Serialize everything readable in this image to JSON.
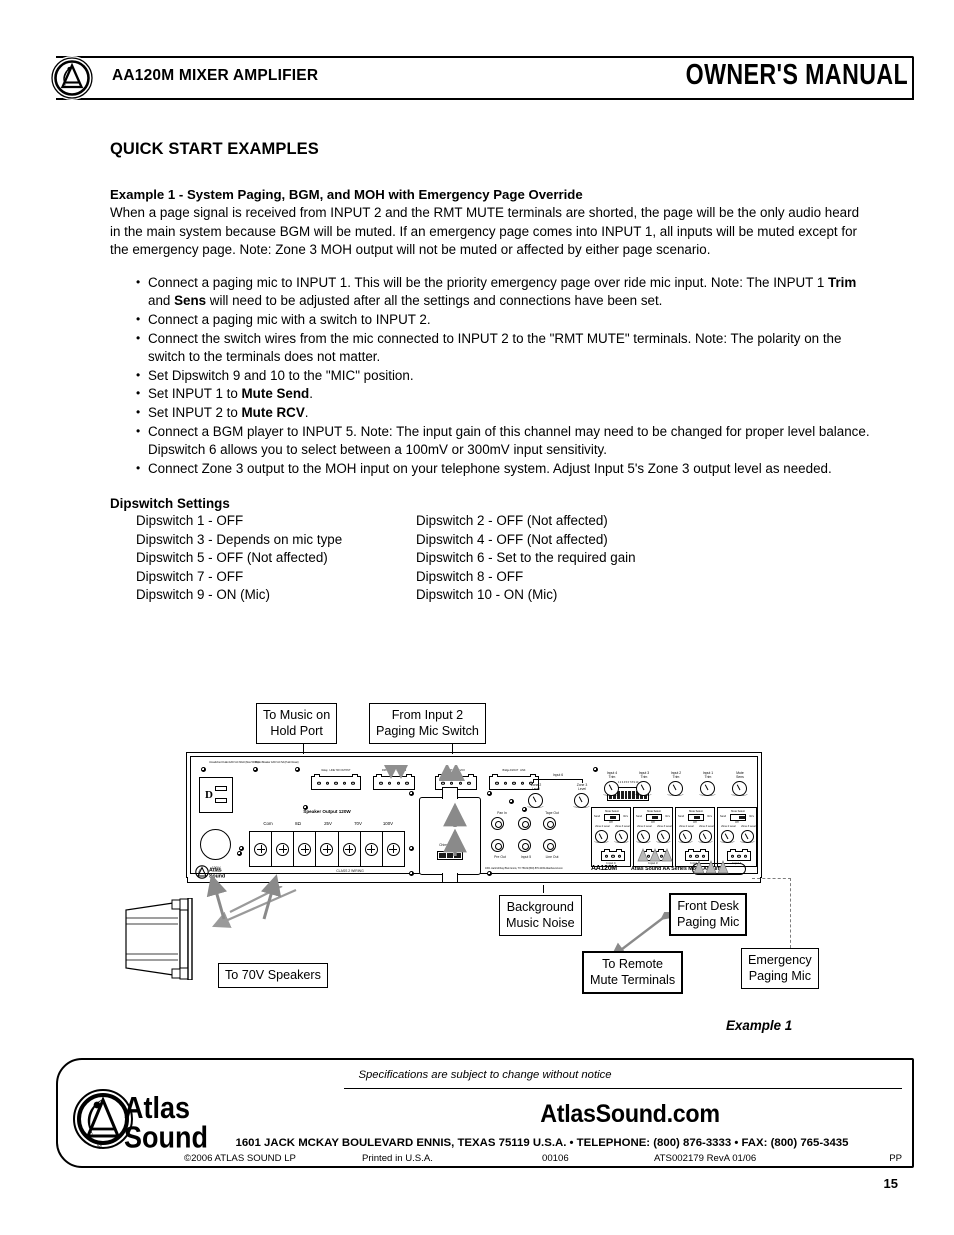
{
  "header": {
    "product_title": "AA120M MIXER AMPLIFIER",
    "manual_label": "OWNER'S MANUAL",
    "logo_name": "atlas-sound-logo"
  },
  "section": {
    "title": "QUICK START EXAMPLES",
    "example_title": "Example 1 - System Paging, BGM, and MOH with Emergency Page Override",
    "intro": "When a page signal is received from INPUT 2 and the RMT MUTE terminals are shorted, the page will be the only audio heard in the main system because BGM will be muted. If an emergency page comes into INPUT 1, all inputs will be muted except for the emergency page. Note: Zone 3 MOH output will not be muted or affected by either page scenario."
  },
  "steps": [
    {
      "parts": [
        {
          "t": "Connect a paging mic to INPUT 1. This will be the priority emergency page over ride mic input. Note: The INPUT 1 ",
          "b": false
        },
        {
          "t": "Trim",
          "b": true
        },
        {
          "t": " and ",
          "b": false
        },
        {
          "t": "Sens",
          "b": true
        },
        {
          "t": " will need to be adjusted after all the settings and connections have been set.",
          "b": false
        }
      ]
    },
    {
      "parts": [
        {
          "t": "Connect a paging mic with a switch to INPUT 2.",
          "b": false
        }
      ]
    },
    {
      "parts": [
        {
          "t": "Connect the switch wires from the mic connected to INPUT 2 to the \"RMT MUTE\" terminals. Note: The polarity on the switch to the terminals does not matter.",
          "b": false
        }
      ]
    },
    {
      "parts": [
        {
          "t": "Set Dipswitch 9 and 10 to the \"MIC\" position.",
          "b": false
        }
      ]
    },
    {
      "parts": [
        {
          "t": "Set INPUT 1 to ",
          "b": false
        },
        {
          "t": "Mute Send",
          "b": true
        },
        {
          "t": ".",
          "b": false
        }
      ]
    },
    {
      "parts": [
        {
          "t": "Set INPUT 2 to ",
          "b": false
        },
        {
          "t": "Mute RCV",
          "b": true
        },
        {
          "t": ".",
          "b": false
        }
      ]
    },
    {
      "parts": [
        {
          "t": "Connect a BGM player to INPUT 5. Note: The input gain of this channel may need to be changed for proper level balance. Dipswitch 6 allows you to select between a 100mV or 300mV input sensitivity.",
          "b": false
        }
      ]
    },
    {
      "parts": [
        {
          "t": "Connect Zone 3 output to the MOH input on your telephone system. Adjust Input 5's Zone 3 output level as needed.",
          "b": false
        }
      ]
    }
  ],
  "dipswitch": {
    "heading": "Dipswitch Settings",
    "rows": [
      {
        "left": "Dipswitch 1 - OFF",
        "right": "Dipswitch 2 - OFF (Not affected)"
      },
      {
        "left": "Dipswitch 3 - Depends on mic type",
        "right": "Dipswitch 4 - OFF (Not affected)"
      },
      {
        "left": "Dipswitch 5 - OFF (Not affected)",
        "right": "Dipswitch 6 - Set to the required gain"
      },
      {
        "left": "Dipswitch 7 - OFF",
        "right": "Dipswitch 8 - OFF"
      },
      {
        "left": "Dipswitch 9 - ON (Mic)",
        "right": "Dipswitch 10 - ON (Mic)"
      }
    ]
  },
  "diagram": {
    "caption": "Example 1",
    "callouts": {
      "music_on_hold": "To Music on\nHold Port",
      "from_input2": "From Input 2\nPaging Mic Switch",
      "background_music": "Background\nMusic Noise",
      "front_desk": "Front Desk\nPaging Mic",
      "remote_mute": "To Remote\nMute Terminals",
      "emergency_mic": "Emergency\nPaging Mic",
      "speakers_70v": "To 70V Speakers"
    },
    "panel": {
      "model": "AA120M",
      "model_sub": "Atlas Sound AA Series Mixer Amplifier",
      "unswitched_outlet": "Unswitched Outlet\n120V AC 60Hz\n(Max 500W)",
      "outlet_breaker": "Outlet Breaker\n120V AC 5A\n(Push Reset)",
      "speaker_output": "Speaker Output 120W",
      "speaker_taps": [
        "Com",
        "8Ω",
        "25V",
        "70V",
        "100V"
      ],
      "class2": "CLASS 2 WIRING",
      "wattage": "120W",
      "chime_module": "Chime Module",
      "jacks": [
        "Pan In",
        "Tape Out",
        "Pre Out",
        "Line Out"
      ],
      "input5_label": "Input 5",
      "input6_label": "Input 6",
      "zone_labels": [
        "Zone 2\nLevel",
        "Zone 3\nLevel"
      ],
      "dip_numbers": "1 2 3 4 5 6 7 8 9 10",
      "trim_labels": [
        "Input 4\nTrim",
        "Input 3\nTrim",
        "Input 2\nTrim",
        "Input 1\nTrim",
        "Mute\nSens"
      ],
      "channel_labels": [
        "Input 4",
        "Input 3",
        "Input 2",
        "Input 1"
      ],
      "mute_switch": [
        "Send",
        "Mute Select",
        "Off",
        "Rcv"
      ],
      "zone_knobs": [
        "Zone 2 Level",
        "Zone 3 Level"
      ],
      "logo_text": "Atlas\nSound",
      "address_micro": "1601 Jack McKay Blvd. Ennis, TX 75119\n(800) 876-3333 AtlasSound.com",
      "rear_terminals": [
        "Relay",
        "LINE 70V OUTPUT",
        "MUTE IN\nRMT MUTE",
        "Zone 2/3\nOUT",
        "Remote Vol.\nRMT VOL",
        "VOX",
        "Bridge\nIN/OUT",
        "LINK"
      ]
    }
  },
  "footer": {
    "spec_note": "Specifications are subject to change without notice",
    "website": "AtlasSound.com",
    "logo_text": "Atlas\nSound",
    "address": "1601 JACK MCKAY BOULEVARD ENNIS, TEXAS 75119 U.S.A.   •   TELEPHONE: (800) 876-3333   •   FAX: (800) 765-3435",
    "copyright": "©2006 ATLAS SOUND LP",
    "printed": "Printed in U.S.A.",
    "code": "00106",
    "doc_id": "ATS002179 RevA 01/06",
    "pp": "PP"
  },
  "page_number": "15",
  "colors": {
    "ink": "#000000",
    "gray_leader": "#8a8a8a"
  }
}
